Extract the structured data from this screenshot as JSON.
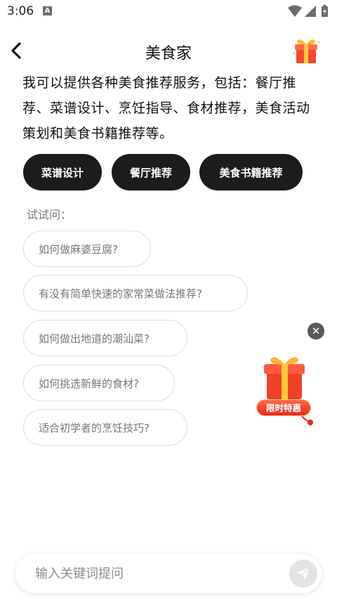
{
  "status_bar": {
    "time": "3:06",
    "notification_badge": "A",
    "icons": [
      "wifi-icon",
      "signal-icon",
      "battery-icon"
    ]
  },
  "header": {
    "title": "美食家",
    "back_icon": "chevron-left-icon",
    "gift_icon": "gift-box-icon"
  },
  "intro": {
    "text": "我可以提供各种美食推荐服务，包括：餐厅推荐、菜谱设计、烹饪指导、食材推荐，美食活动策划和美食书籍推荐等。"
  },
  "chips": [
    {
      "label": "菜谱设计"
    },
    {
      "label": "餐厅推荐"
    },
    {
      "label": "美食书籍推荐"
    }
  ],
  "suggestions": {
    "label": "试试问：",
    "items": [
      "如何做麻婆豆腐?",
      "有没有简单快速的家常菜做法推荐?",
      "如何做出地道的潮汕菜?",
      "如何挑选新鲜的食材?",
      "适合初学者的烹饪技巧?"
    ]
  },
  "promo": {
    "label": "限时特惠",
    "close_icon": "close-icon"
  },
  "input": {
    "placeholder": "输入关键词提问",
    "value": "",
    "send_icon": "send-icon"
  },
  "colors": {
    "chip_bg": "#1c1c1c",
    "chip_text": "#ffffff",
    "suggestion_border": "#dedede",
    "suggestion_text": "#777777",
    "promo_red": "#e8281f",
    "promo_gold": "#ffd36b"
  }
}
